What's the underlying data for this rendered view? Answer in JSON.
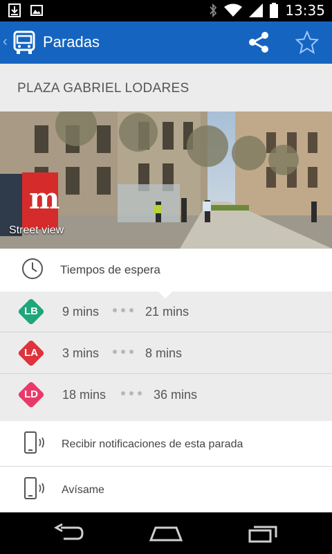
{
  "status_bar": {
    "time": "13:35",
    "icons": [
      "download-icon",
      "image-icon",
      "bluetooth-icon",
      "wifi-icon",
      "signal-icon",
      "battery-icon"
    ]
  },
  "app_bar": {
    "title": "Paradas",
    "back_icon": "chevron-left-icon",
    "app_icon": "bus-icon",
    "actions": [
      "share-icon",
      "star-icon"
    ],
    "color": "#1565c0"
  },
  "stop": {
    "name": "PLAZA GABRIEL LODARES"
  },
  "street_view": {
    "label": "Street view"
  },
  "wait_times": {
    "label": "Tiempos de espera",
    "icon": "clock-icon",
    "lines": [
      {
        "code": "LB",
        "color": "#1fa67a",
        "first": "9 mins",
        "second": "21 mins"
      },
      {
        "code": "LA",
        "color": "#e0323b",
        "first": "3 mins",
        "second": "8 mins"
      },
      {
        "code": "LD",
        "color": "#e83a6a",
        "first": "18 mins",
        "second": "36 mins"
      }
    ]
  },
  "actions": [
    {
      "label": "Recibir notificaciones de esta parada",
      "icon": "phone-vibrate-icon"
    },
    {
      "label": "Avísame",
      "icon": "phone-vibrate-icon"
    }
  ],
  "nav_bar": {
    "buttons": [
      "back-icon",
      "home-icon",
      "recents-icon"
    ]
  }
}
